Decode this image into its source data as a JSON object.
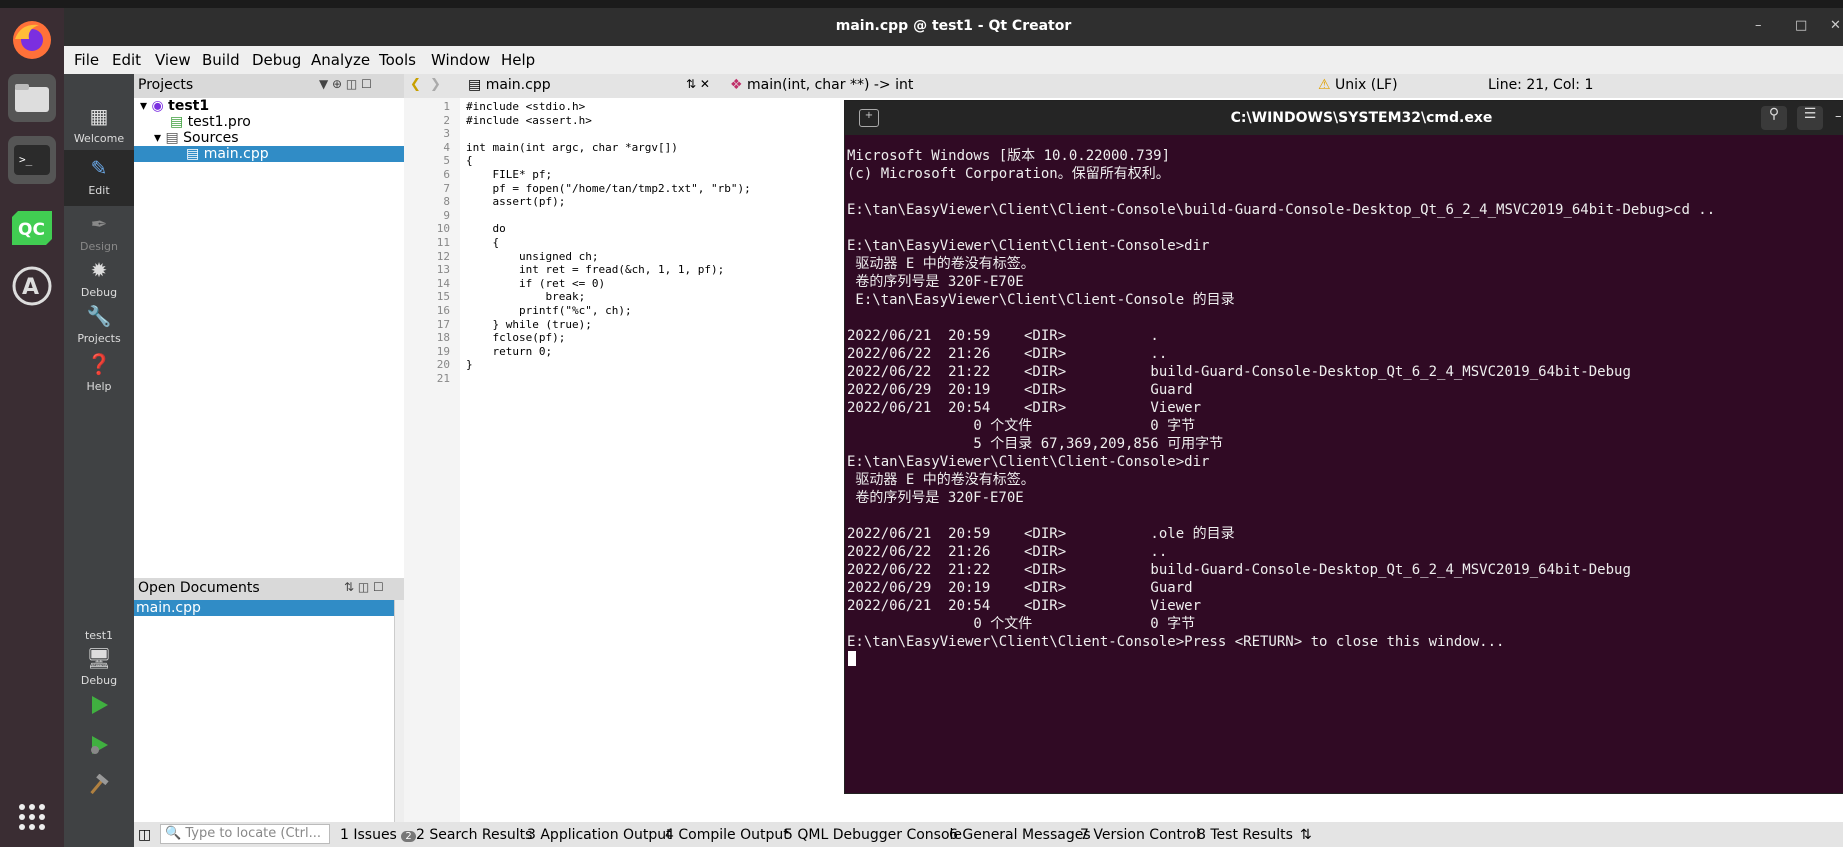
{
  "window": {
    "title": "main.cpp @ test1 - Qt Creator"
  },
  "menu": [
    "File",
    "Edit",
    "View",
    "Build",
    "Debug",
    "Analyze",
    "Tools",
    "Window",
    "Help"
  ],
  "modes": [
    {
      "label": "Welcome",
      "icon": "grid-icon"
    },
    {
      "label": "Edit",
      "icon": "edit-icon"
    },
    {
      "label": "Design",
      "icon": "pen-icon"
    },
    {
      "label": "Debug",
      "icon": "bug-icon"
    },
    {
      "label": "Projects",
      "icon": "wrench-icon"
    },
    {
      "label": "Help",
      "icon": "help-icon"
    }
  ],
  "kit": {
    "project": "test1",
    "mode": "Debug"
  },
  "projects": {
    "title": "Projects",
    "tree": [
      "test1",
      "test1.pro",
      "Sources",
      "main.cpp"
    ]
  },
  "open_documents": {
    "title": "Open Documents",
    "items": [
      "main.cpp"
    ]
  },
  "editor": {
    "file": "main.cpp",
    "function": "main(int, char **) -> int",
    "line_ending": "Unix (LF)",
    "position": "Line: 21, Col: 1",
    "lines": [
      "#include <stdio.h>",
      "#include <assert.h>",
      "",
      "int main(int argc, char *argv[])",
      "{",
      "    FILE* pf;",
      "    pf = fopen(\"/home/tan/tmp2.txt\", \"rb\");",
      "    assert(pf);",
      "",
      "    do",
      "    {",
      "        unsigned ch;",
      "        int ret = fread(&ch, 1, 1, pf);",
      "        if (ret <= 0)",
      "            break;",
      "        printf(\"%c\", ch);",
      "    } while (true);",
      "    fclose(pf);",
      "    return 0;",
      "}",
      ""
    ]
  },
  "status_tabs": [
    {
      "label": "Type to locate (Ctrl...",
      "kind": "input"
    },
    {
      "label": "1  Issues",
      "badge": "2"
    },
    {
      "label": "2  Search Results"
    },
    {
      "label": "3  Application Output"
    },
    {
      "label": "4  Compile Output"
    },
    {
      "label": "5  QML Debugger Console"
    },
    {
      "label": "6  General Messages"
    },
    {
      "label": "7  Version Control"
    },
    {
      "label": "8  Test Results"
    }
  ],
  "cmd": {
    "title": "C:\\WINDOWS\\SYSTEM32\\cmd.exe",
    "text": "Microsoft Windows [版本 10.0.22000.739]\n(c) Microsoft Corporation。保留所有权利。\n\nE:\\tan\\EasyViewer\\Client\\Client-Console\\build-Guard-Console-Desktop_Qt_6_2_4_MSVC2019_64bit-Debug>cd ..\n\nE:\\tan\\EasyViewer\\Client\\Client-Console>dir\n 驱动器 E 中的卷没有标签。\n 卷的序列号是 320F-E70E\n E:\\tan\\EasyViewer\\Client\\Client-Console 的目录\n\n2022/06/21  20:59    <DIR>          .\n2022/06/22  21:26    <DIR>          ..\n2022/06/22  21:22    <DIR>          build-Guard-Console-Desktop_Qt_6_2_4_MSVC2019_64bit-Debug\n2022/06/29  20:19    <DIR>          Guard\n2022/06/21  20:54    <DIR>          Viewer\n               0 个文件              0 字节\n               5 个目录 67,369,209,856 可用字节\nE:\\tan\\EasyViewer\\Client\\Client-Console>dir\n 驱动器 E 中的卷没有标签。\n 卷的序列号是 320F-E70E\n\n2022/06/21  20:59    <DIR>          .ole 的目录\n2022/06/22  21:26    <DIR>          ..\n2022/06/22  21:22    <DIR>          build-Guard-Console-Desktop_Qt_6_2_4_MSVC2019_64bit-Debug\n2022/06/29  20:19    <DIR>          Guard\n2022/06/21  20:54    <DIR>          Viewer\n               0 个文件              0 字节\nE:\\tan\\EasyViewer\\Client\\Client-Console>Press <RETURN> to close this window..."
  },
  "colors": {
    "selection": "#308cc6",
    "terminal_bg": "#300a24",
    "dock_bg": "#3a2d33"
  }
}
